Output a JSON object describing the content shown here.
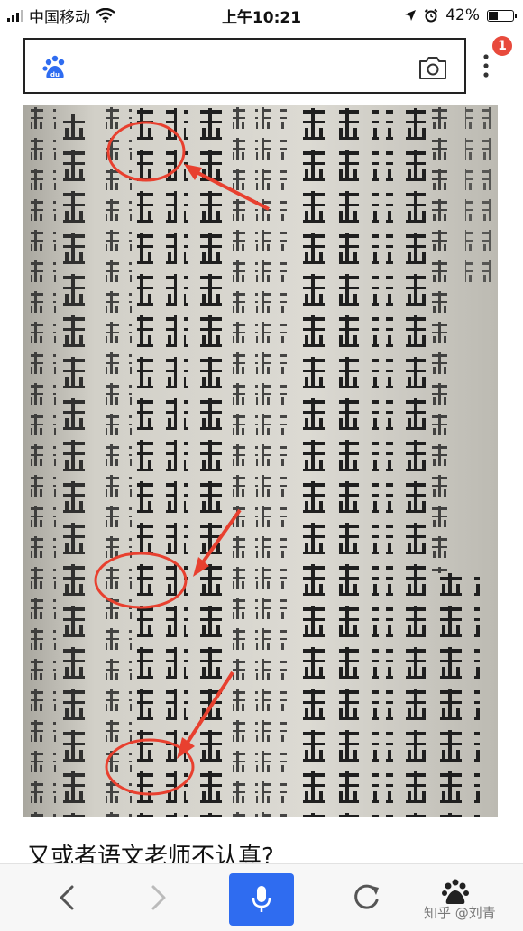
{
  "status_bar": {
    "carrier": "中国移动",
    "time": "上午10:21",
    "battery_percent": "42%",
    "battery_level": 0.42
  },
  "search": {
    "query": "",
    "notification_count": "1"
  },
  "article": {
    "caption": "又或者语文老师不认真?"
  },
  "toolbar": {
    "watermark": "知乎 @刘青"
  },
  "colors": {
    "voice_button": "#2f6cf0",
    "badge": "#e84a3c",
    "baidu_blue": "#2f6cf0"
  },
  "icons": [
    "signal-icon",
    "wifi-icon",
    "location-icon",
    "alarm-icon",
    "battery-icon",
    "baidu-paw-icon",
    "camera-icon",
    "more-icon",
    "back-icon",
    "forward-icon",
    "microphone-icon",
    "refresh-icon",
    "paw-icon"
  ]
}
